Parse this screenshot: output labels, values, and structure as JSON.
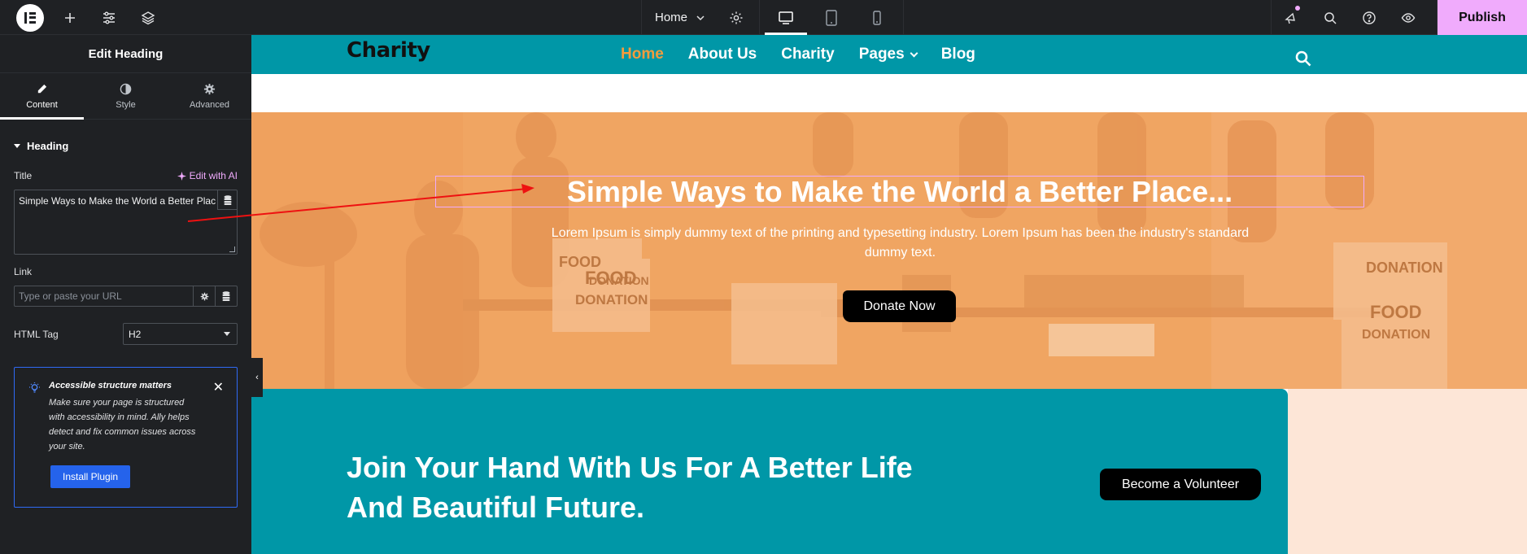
{
  "topbar": {
    "page_name": "Home",
    "publish_label": "Publish",
    "icons": [
      "elementor-logo-icon",
      "add-icon",
      "settings-sliders-icon",
      "layers-icon",
      "gear-icon",
      "desktop-icon",
      "tablet-icon",
      "mobile-icon",
      "notifications-icon",
      "search-icon",
      "help-icon",
      "preview-eye-icon"
    ],
    "colors": {
      "bg": "#1f2124",
      "publish_bg": "#f0abfc"
    }
  },
  "panel": {
    "title": "Edit Heading",
    "tabs": [
      {
        "label": "Content",
        "icon": "pencil-icon",
        "active": true
      },
      {
        "label": "Style",
        "icon": "contrast-icon",
        "active": false
      },
      {
        "label": "Advanced",
        "icon": "gear-icon",
        "active": false
      }
    ],
    "section_title": "Heading",
    "title_label": "Title",
    "edit_ai_label": "Edit with AI",
    "title_value": "Simple Ways to Make the World a Better Plac",
    "link_label": "Link",
    "link_placeholder": "Type or paste your URL",
    "html_tag_label": "HTML Tag",
    "html_tag_value": "H2",
    "notice": {
      "title": "Accessible structure matters",
      "body": "Make sure your page is structured with accessibility in mind. Ally helps detect and fix common issues across your site.",
      "button": "Install Plugin"
    }
  },
  "site": {
    "brand": "Charity",
    "nav": [
      {
        "label": "Home",
        "active": true
      },
      {
        "label": "About Us",
        "active": false
      },
      {
        "label": "Charity",
        "active": false
      },
      {
        "label": "Pages",
        "active": false
      },
      {
        "label": "Blog",
        "active": false
      }
    ],
    "colors": {
      "header": "#0097a7",
      "nav_active": "#f39c3d",
      "hero_overlay": "#f2a865",
      "join_right": "#fde6d7"
    },
    "hero": {
      "title": "Simple Ways to Make the World a Better Place...",
      "text": "Lorem Ipsum is simply dummy text of the printing and typesetting industry. Lorem Ipsum has been the industry's standard dummy text.",
      "button": "Donate Now",
      "box_labels": [
        "FOOD",
        "DONATION",
        "FOOD",
        "DONATION",
        "DONATION",
        "FOOD",
        "DONATION"
      ]
    },
    "join": {
      "title": "Join Your Hand With Us For A Better Life And Beautiful Future.",
      "button": "Become a Volunteer"
    }
  }
}
